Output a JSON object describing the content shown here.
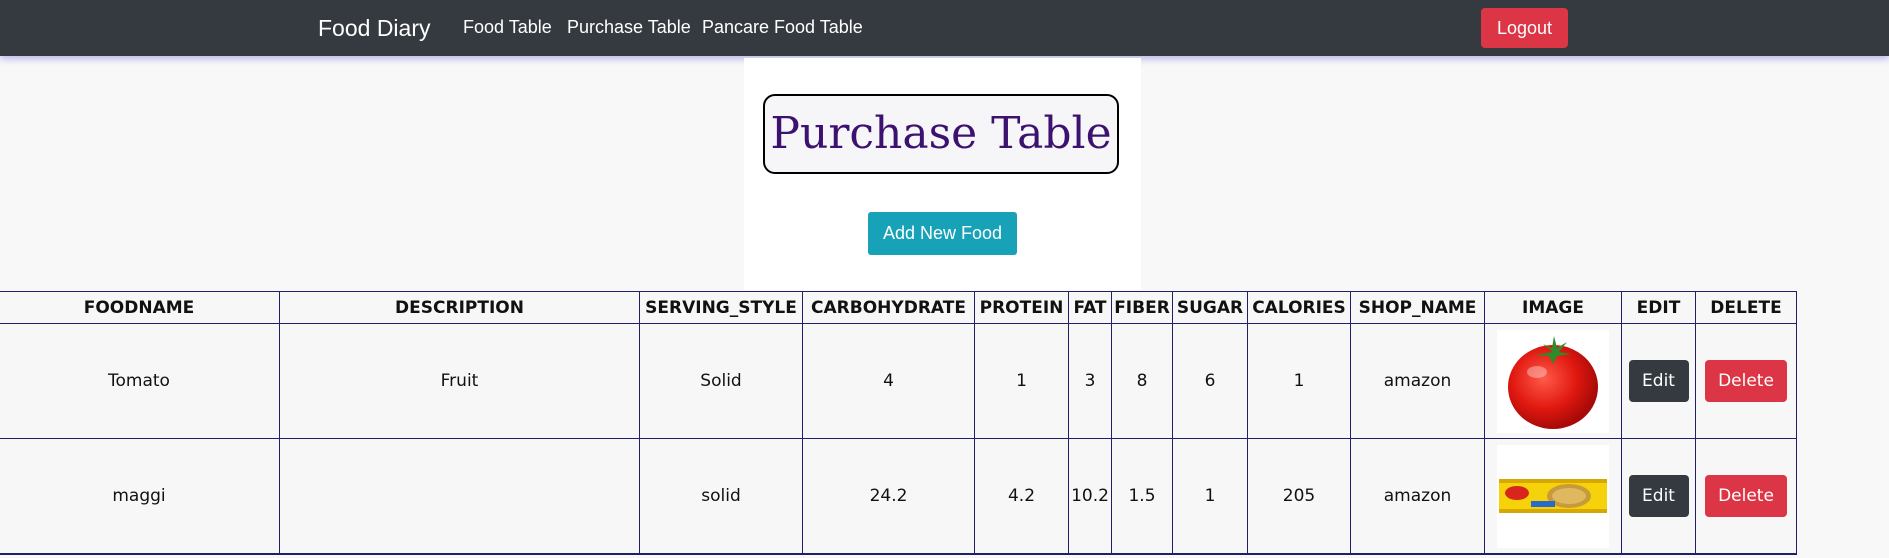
{
  "navbar": {
    "brand": "Food Diary",
    "links": [
      "Food Table",
      "Purchase Table",
      "Pancare Food Table"
    ],
    "logout_label": "Logout"
  },
  "page": {
    "title": "Purchase Table",
    "add_button_label": "Add New Food"
  },
  "table": {
    "headers": [
      "FOODNAME",
      "DESCRIPTION",
      "SERVING_STYLE",
      "CARBOHYDRATE",
      "PROTEIN",
      "FAT",
      "FIBER",
      "SUGAR",
      "CALORIES",
      "SHOP_NAME",
      "IMAGE",
      "EDIT",
      "DELETE"
    ],
    "rows": [
      {
        "foodname": "Tomato",
        "description": "Fruit",
        "serving_style": "Solid",
        "carbohydrate": "4",
        "protein": "1",
        "fat": "3",
        "fiber": "8",
        "sugar": "6",
        "calories": "1",
        "shop_name": "amazon",
        "image": "tomato-image",
        "edit_label": "Edit",
        "delete_label": "Delete"
      },
      {
        "foodname": "maggi",
        "description": "",
        "serving_style": "solid",
        "carbohydrate": "24.2",
        "protein": "4.2",
        "fat": "10.2",
        "fiber": "1.5",
        "sugar": "1",
        "calories": "205",
        "shop_name": "amazon",
        "image": "maggi-noodles-image",
        "edit_label": "Edit",
        "delete_label": "Delete"
      }
    ]
  },
  "colors": {
    "navbar_bg": "#343a40",
    "logout_bg": "#dc3545",
    "add_bg": "#17a2b8",
    "title_color": "#3d1170",
    "table_border": "#1f1f6a"
  }
}
